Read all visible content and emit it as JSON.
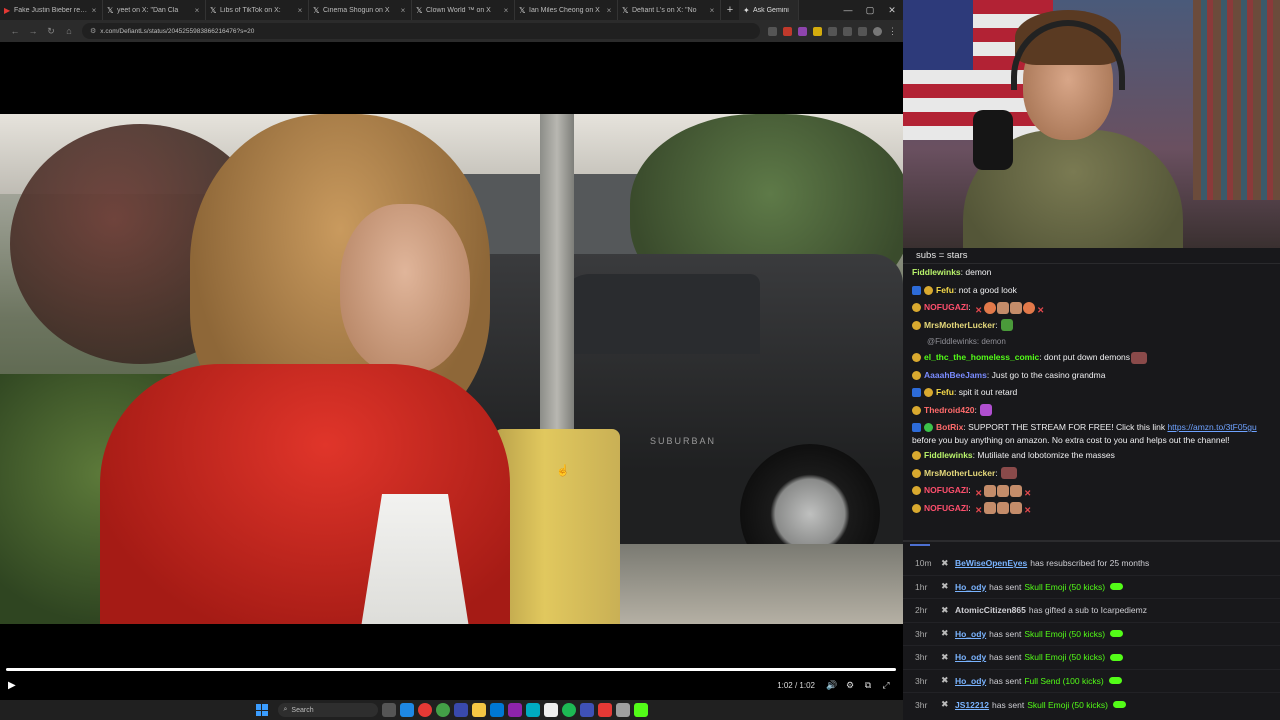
{
  "browser": {
    "tabs": [
      {
        "label": "Fake Justin Bieber rep pu"
      },
      {
        "label": "yeet on X: \"Dan Cla"
      },
      {
        "label": "Libs of TikTok on X:"
      },
      {
        "label": "Cinema Shogun on X"
      },
      {
        "label": "Clown World ™ on X"
      },
      {
        "label": "Ian Miles Cheong on X"
      },
      {
        "label": "Defiant L's on X: \"No"
      }
    ],
    "gemini_label": "Ask Gemini",
    "url": "x.com/DefiantLs/status/2045255983866216476?s=20"
  },
  "player": {
    "time": "1:02 / 1:02",
    "truck_badge": "SUBURBAN"
  },
  "taskbar": {
    "search_label": "Search"
  },
  "chat": {
    "header": "subs = stars",
    "messages": [
      {
        "user": "Fiddlewinks",
        "color": "#b9f36b",
        "text": "demon"
      },
      {
        "user": "Fefu",
        "color": "#f5d94a",
        "text": "not a good look"
      },
      {
        "user": "NOFUGAZI",
        "color": "#ff4f6d",
        "text": ""
      },
      {
        "user": "MrsMotherLucker",
        "color": "#e5d87b",
        "text": ""
      },
      {
        "reply": "@Fiddlewinks: demon"
      },
      {
        "user": "el_thc_the_homeless_comic",
        "color": "#53fc18",
        "text": "dont put down demons"
      },
      {
        "user": "AaaahBeeJams",
        "color": "#7a8cff",
        "text": "Just go to the casino grandma"
      },
      {
        "user": "Fefu",
        "color": "#f5d94a",
        "text": "spit it out retard"
      },
      {
        "user": "Thedroid420",
        "color": "#ff6b6b",
        "text": ""
      },
      {
        "user": "BotRix",
        "color": "#ff6b6b",
        "text": "SUPPORT THE STREAM FOR FREE! Click this link",
        "link": "https://amzn.to/3tF05gu",
        "text2": "before you buy anything on amazon. No extra cost to you and helps out the channel!"
      },
      {
        "user": "Fiddlewinks",
        "color": "#b9f36b",
        "text": "Mutiliate and lobotomize the masses"
      },
      {
        "user": "MrsMotherLucker",
        "color": "#e5d87b",
        "text": ""
      },
      {
        "user": "NOFUGAZI",
        "color": "#ff4f6d",
        "text": ""
      },
      {
        "user": "NOFUGAZI",
        "color": "#ff4f6d",
        "text": ""
      }
    ]
  },
  "feed": [
    {
      "time": "10m",
      "user": "BeWiseOpenEyes",
      "action": "has resubscribed for 25 months",
      "item": ""
    },
    {
      "time": "1hr",
      "user": "Ho_ody",
      "action": "has sent",
      "item": "Skull Emoji (50 kicks)"
    },
    {
      "time": "2hr",
      "user": "AtomicCitizen865",
      "action": "has gifted a sub to Icarpediemz",
      "item": ""
    },
    {
      "time": "3hr",
      "user": "Ho_ody",
      "action": "has sent",
      "item": "Skull Emoji (50 kicks)"
    },
    {
      "time": "3hr",
      "user": "Ho_ody",
      "action": "has sent",
      "item": "Skull Emoji (50 kicks)"
    },
    {
      "time": "3hr",
      "user": "Ho_ody",
      "action": "has sent",
      "item": "Full Send (100 kicks)"
    },
    {
      "time": "3hr",
      "user": "JS12212",
      "action": "has sent",
      "item": "Skull Emoji (50 kicks)"
    }
  ],
  "colors": {
    "kick_green": "#53fc18",
    "chat_bg": "#18181b",
    "link_blue": "#6ea2ff"
  }
}
